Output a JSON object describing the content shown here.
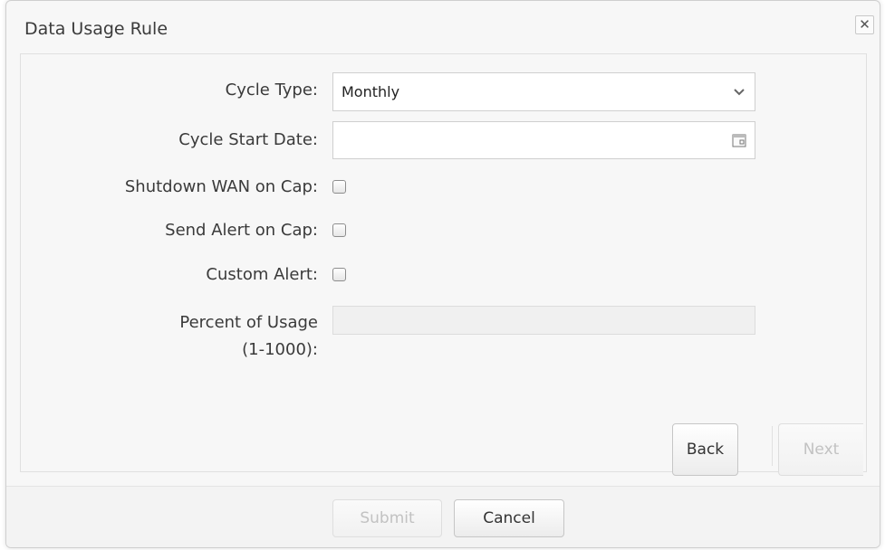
{
  "dialog": {
    "title": "Data Usage Rule",
    "close_glyph": "✕"
  },
  "form": {
    "cycle_type": {
      "label": "Cycle Type:",
      "value": "Monthly"
    },
    "cycle_start_date": {
      "label": "Cycle Start Date:",
      "value": ""
    },
    "shutdown_wan": {
      "label": "Shutdown WAN on Cap:",
      "checked": false
    },
    "send_alert": {
      "label": "Send Alert on Cap:",
      "checked": false
    },
    "custom_alert": {
      "label": "Custom Alert:",
      "checked": false
    },
    "percent_usage": {
      "label_line1": "Percent of Usage",
      "label_line2": "(1-1000):",
      "value": "",
      "disabled": true
    }
  },
  "wizard": {
    "back_label": "Back",
    "next_label": "Next"
  },
  "footer": {
    "submit_label": "Submit",
    "cancel_label": "Cancel"
  },
  "icons": {
    "close": "close-icon",
    "dropdown": "chevron-down-icon",
    "calendar": "calendar-icon"
  }
}
